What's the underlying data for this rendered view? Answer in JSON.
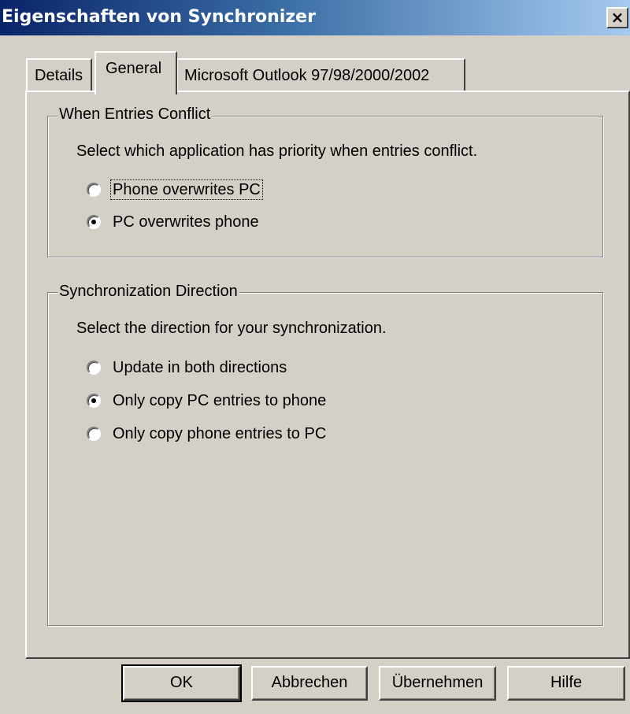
{
  "window": {
    "title": "Eigenschaften von Synchronizer",
    "close_label": "×"
  },
  "tabs": [
    {
      "label": "Details",
      "active": false
    },
    {
      "label": "General",
      "active": true
    },
    {
      "label": "Microsoft Outlook 97/98/2000/2002",
      "active": false
    }
  ],
  "conflict_group": {
    "legend": "When Entries Conflict",
    "description": "Select which application has priority when entries conflict.",
    "options": [
      {
        "label": "Phone overwrites PC",
        "selected": false,
        "focused": true
      },
      {
        "label": "PC overwrites phone",
        "selected": true,
        "focused": false
      }
    ]
  },
  "direction_group": {
    "legend": "Synchronization Direction",
    "description": "Select the direction for your synchronization.",
    "options": [
      {
        "label": "Update in both directions",
        "selected": false
      },
      {
        "label": "Only copy PC entries to phone",
        "selected": true
      },
      {
        "label": "Only copy phone entries to PC",
        "selected": false
      }
    ]
  },
  "buttons": {
    "ok": "OK",
    "cancel": "Abbrechen",
    "apply": "Übernehmen",
    "help": "Hilfe"
  },
  "colors": {
    "titlebar_start": "#0a246a",
    "titlebar_end": "#a6caf0",
    "face": "#d4d0c8"
  }
}
